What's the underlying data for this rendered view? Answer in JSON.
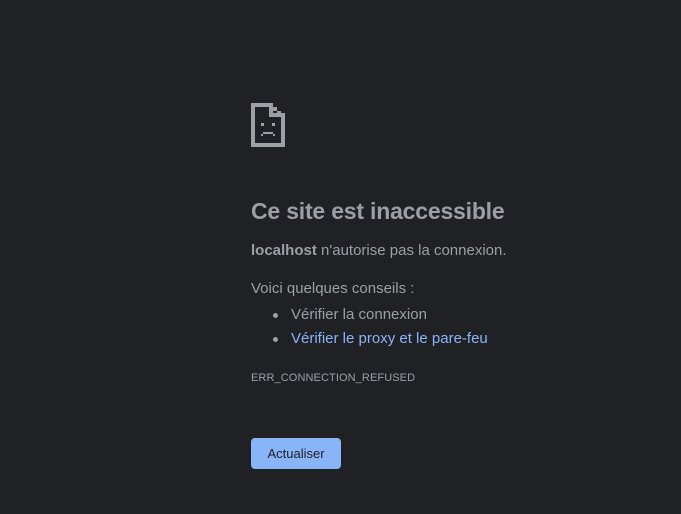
{
  "error_page": {
    "icon": "sad-page-icon",
    "title": "Ce site est inaccessible",
    "host": "localhost",
    "subtitle_rest": " n'autorise pas la connexion.",
    "tips_heading": "Voici quelques conseils :",
    "tips": [
      {
        "label": "Vérifier la connexion",
        "is_link": false
      },
      {
        "label": "Vérifier le proxy et le pare-feu",
        "is_link": true
      }
    ],
    "error_code": "ERR_CONNECTION_REFUSED",
    "reload_label": "Actualiser"
  },
  "colors": {
    "background": "#202124",
    "text": "#9aa0a6",
    "link": "#8ab4f8",
    "button_background": "#8ab4f8",
    "button_text": "#202124",
    "icon": "#9aa0a6"
  }
}
